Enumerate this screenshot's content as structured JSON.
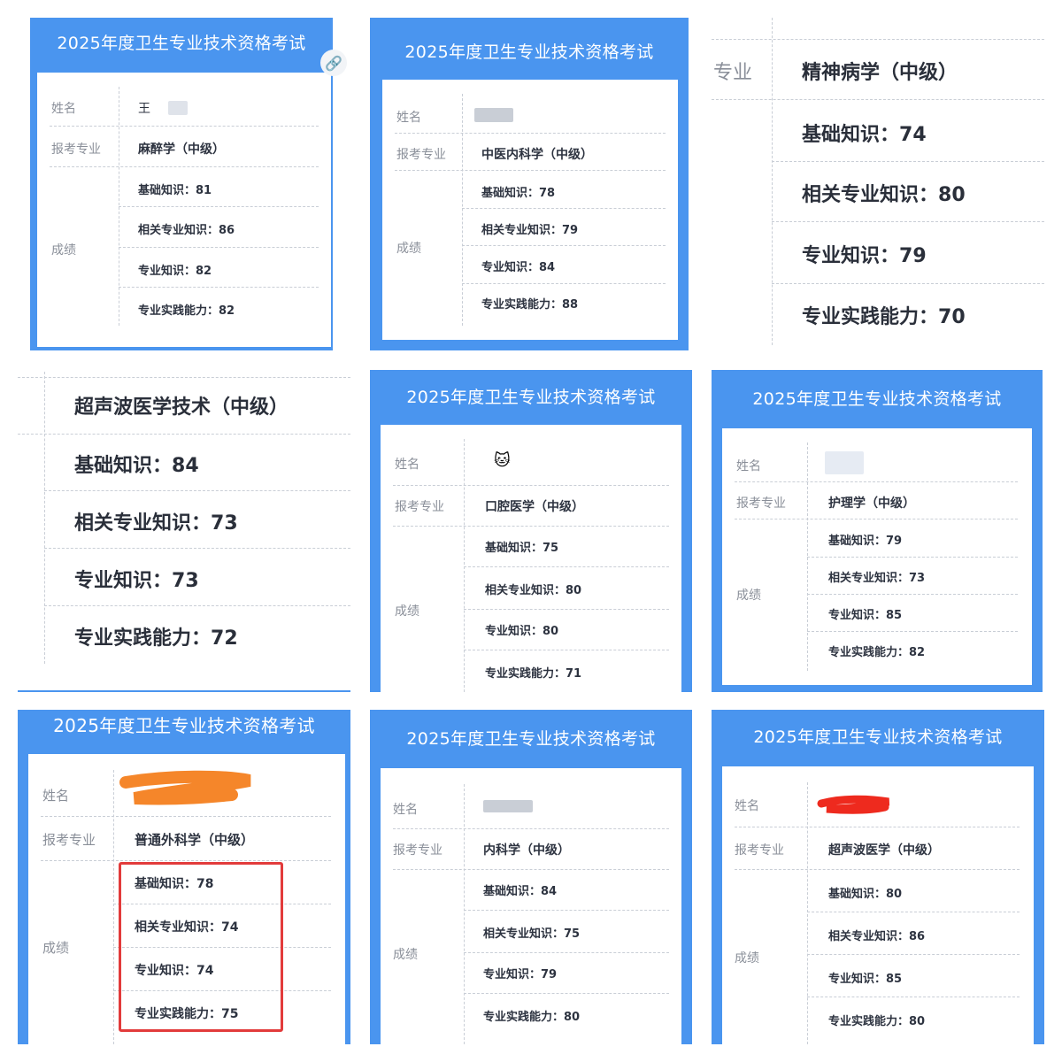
{
  "exam_title": "2025年度卫生专业技术资格考试",
  "labels": {
    "name": "姓名",
    "major": "报考专业",
    "scores": "成绩",
    "major_short": "专业"
  },
  "score_labels": {
    "basic": "基础知识：",
    "related": "相关专业知识：",
    "professional": "专业知识：",
    "practice": "专业实践能力："
  },
  "cards": [
    {
      "name_partial": "王",
      "major": "麻醉学（中级）",
      "basic": "81",
      "related": "86",
      "professional": "82",
      "practice": "82"
    },
    {
      "name_partial": "",
      "major": "中医内科学（中级）",
      "basic": "78",
      "related": "79",
      "professional": "84",
      "practice": "88"
    },
    {
      "major": "精神病学（中级）",
      "basic": "74",
      "related": "80",
      "professional": "79",
      "practice": "70"
    },
    {
      "major": "超声波医学技术（中级）",
      "basic": "84",
      "related": "73",
      "professional": "73",
      "practice": "72"
    },
    {
      "name_partial": "",
      "major": "口腔医学（中级）",
      "basic": "75",
      "related": "80",
      "professional": "80",
      "practice": "71"
    },
    {
      "name_partial": "",
      "major": "护理学（中级）",
      "basic": "79",
      "related": "73",
      "professional": "85",
      "practice": "82"
    },
    {
      "name_partial": "",
      "major": "普通外科学（中级）",
      "basic": "78",
      "related": "74",
      "professional": "74",
      "practice": "75"
    },
    {
      "name_partial": "",
      "major": "内科学（中级）",
      "basic": "84",
      "related": "75",
      "professional": "79",
      "practice": "80"
    },
    {
      "name_partial": "",
      "major": "超声波医学（中级）",
      "basic": "80",
      "related": "86",
      "professional": "85",
      "practice": "80"
    }
  ],
  "colors": {
    "frame_blue": "#4a95ef",
    "highlight_red": "#e23b3b",
    "scribble_orange": "#f5862a",
    "scribble_red": "#ee2a1e"
  }
}
